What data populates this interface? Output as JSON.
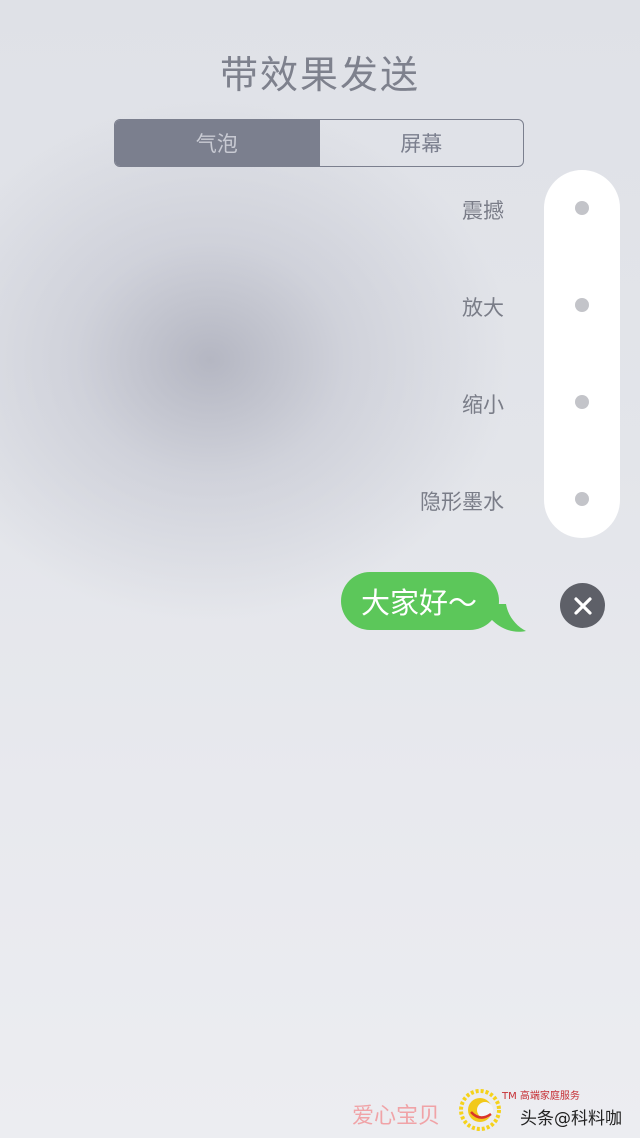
{
  "title": "带效果发送",
  "segments": [
    {
      "label": "气泡",
      "selected": true
    },
    {
      "label": "屏幕",
      "selected": false
    }
  ],
  "effects": [
    {
      "label": "震撼"
    },
    {
      "label": "放大"
    },
    {
      "label": "缩小"
    },
    {
      "label": "隐形墨水"
    }
  ],
  "message": {
    "text": "大家好～"
  },
  "colors": {
    "bubble": "#5cc75a",
    "close_button": "#5e6068",
    "segment_active": "#7b7f8e",
    "background": "#e3e5ea"
  },
  "icons": {
    "close": "close-icon",
    "logo": "sun-logo-icon"
  },
  "watermark": {
    "left_text": "爱心宝贝",
    "tm_text": "TM 高端家庭服务",
    "right_text": "头条@科料咖"
  }
}
